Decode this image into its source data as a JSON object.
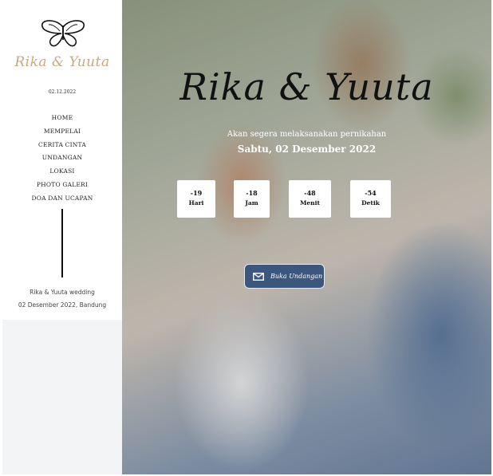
{
  "sidebar": {
    "brand": "Rika & Yuuta",
    "date": "02.12.2022",
    "nav": [
      "HOME",
      "MEMPELAI",
      "CERITA CINTA",
      "UNDANGAN",
      "LOKASI",
      "PHOTO GALERI",
      "DOA DAN UCAPAN"
    ],
    "footer_line1": "Rika & Yuuta wedding",
    "footer_line2": "02 Desember 2022, Bandung"
  },
  "hero": {
    "title": "Rika & Yuuta",
    "subtitle": "Akan segera melaksanakan pernikahan",
    "date": "Sabtu, 02 Desember 2022",
    "countdown": [
      {
        "value": "-19",
        "label": "Hari"
      },
      {
        "value": "-18",
        "label": "Jam"
      },
      {
        "value": "-48",
        "label": "Menit"
      },
      {
        "value": "-54",
        "label": "Detik"
      }
    ],
    "button_label": "Buka Undangan"
  },
  "icons": {
    "logo": "butterfly-icon",
    "button": "mail-icon"
  },
  "colors": {
    "brand_gold": "#c8a97e",
    "button_bg": "#3c577d",
    "sidebar_bottom": "#f3f4f6"
  }
}
